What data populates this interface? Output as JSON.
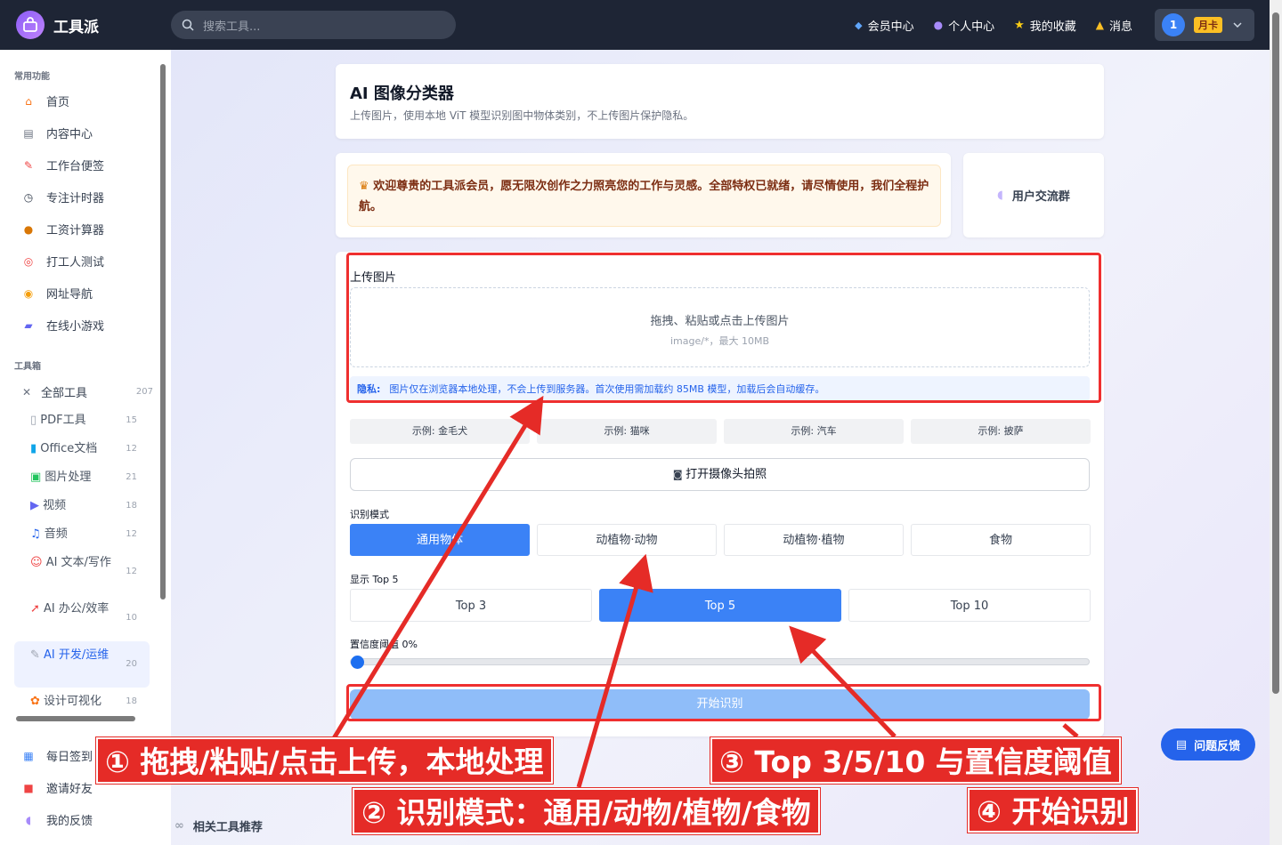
{
  "header": {
    "logo_text": "工具派",
    "search_placeholder": "搜索工具...",
    "nav": [
      {
        "icon": "diamond-icon",
        "label": "会员中心"
      },
      {
        "icon": "person-icon",
        "label": "个人中心"
      },
      {
        "icon": "star-icon",
        "label": "我的收藏"
      },
      {
        "icon": "bell-icon",
        "label": "消息"
      }
    ],
    "user": {
      "avatar": "1",
      "badge": "月卡"
    }
  },
  "sidebar": {
    "section_common": "常用功能",
    "common": [
      {
        "icon": "home-icon",
        "label": "首页"
      },
      {
        "icon": "content-icon",
        "label": "内容中心"
      },
      {
        "icon": "note-icon",
        "label": "工作台便签"
      },
      {
        "icon": "timer-icon",
        "label": "专注计时器"
      },
      {
        "icon": "money-icon",
        "label": "工资计算器"
      },
      {
        "icon": "target-icon",
        "label": "打工人测试"
      },
      {
        "icon": "compass-icon",
        "label": "网址导航"
      },
      {
        "icon": "gamepad-icon",
        "label": "在线小游戏"
      }
    ],
    "section_tools": "工具箱",
    "all_tools": {
      "label": "全部工具",
      "count": "207"
    },
    "tools": [
      {
        "icon": "pdf-icon",
        "label": "PDF工具",
        "count": "15"
      },
      {
        "icon": "office-icon",
        "label": "Office文档",
        "count": "12"
      },
      {
        "icon": "image-icon",
        "label": "图片处理",
        "count": "21"
      },
      {
        "icon": "video-icon",
        "label": "视频",
        "count": "18"
      },
      {
        "icon": "music-icon",
        "label": "音频",
        "count": "12"
      },
      {
        "icon": "robot-icon",
        "label": "AI 文本/写作",
        "count": "12"
      },
      {
        "icon": "rocket-icon",
        "label": "AI 办公/效率",
        "count": "10"
      },
      {
        "icon": "wrench-icon",
        "label": "AI 开发/运维",
        "count": "20"
      },
      {
        "icon": "palette-icon",
        "label": "设计可视化",
        "count": "18"
      }
    ],
    "bottom": [
      {
        "icon": "calendar-icon",
        "label": "每日签到"
      },
      {
        "icon": "gift-icon",
        "label": "邀请好友"
      },
      {
        "icon": "chat-icon",
        "label": "我的反馈"
      }
    ]
  },
  "page": {
    "title": "AI 图像分类器",
    "subtitle": "上传图片，使用本地 ViT 模型识别图中物体类别，不上传图片保护隐私。",
    "welcome": "欢迎尊贵的工具派会员，愿无限次创作之力照亮您的工作与灵感。全部特权已就绪，请尽情使用，我们全程护航。",
    "group_label": "用户交流群"
  },
  "upload": {
    "label": "上传图片",
    "drop_text": "拖拽、粘贴或点击上传图片",
    "drop_hint": "image/*，最大 10MB",
    "privacy_label": "隐私:",
    "privacy_text": "图片仅在浏览器本地处理，不会上传到服务器。首次使用需加载约 85MB 模型，加载后会自动缓存。"
  },
  "examples": [
    "示例: 金毛犬",
    "示例: 猫咪",
    "示例: 汽车",
    "示例: 披萨"
  ],
  "camera_label": "打开摄像头拍照",
  "mode": {
    "label": "识别模式",
    "options": [
      "通用物体",
      "动植物·动物",
      "动植物·植物",
      "食物"
    ],
    "selected": "通用物体"
  },
  "topn": {
    "label": "显示 Top 5",
    "options": [
      "Top 3",
      "Top 5",
      "Top 10"
    ],
    "selected": "Top 5"
  },
  "threshold": {
    "label": "置信度阈值 0%",
    "value": 0
  },
  "start_label": "开始识别",
  "annotations": [
    "① 拖拽/粘贴/点击上传，本地处理",
    "② 识别模式：通用/动物/植物/食物",
    "③ Top 3/5/10 与置信度阈值",
    "④ 开始识别"
  ],
  "feedback_label": "问题反馈",
  "related_label": "相关工具推荐",
  "colors": {
    "accent": "#3b82f6",
    "topbar": "#1e2535",
    "annotation": "#e52b27"
  }
}
